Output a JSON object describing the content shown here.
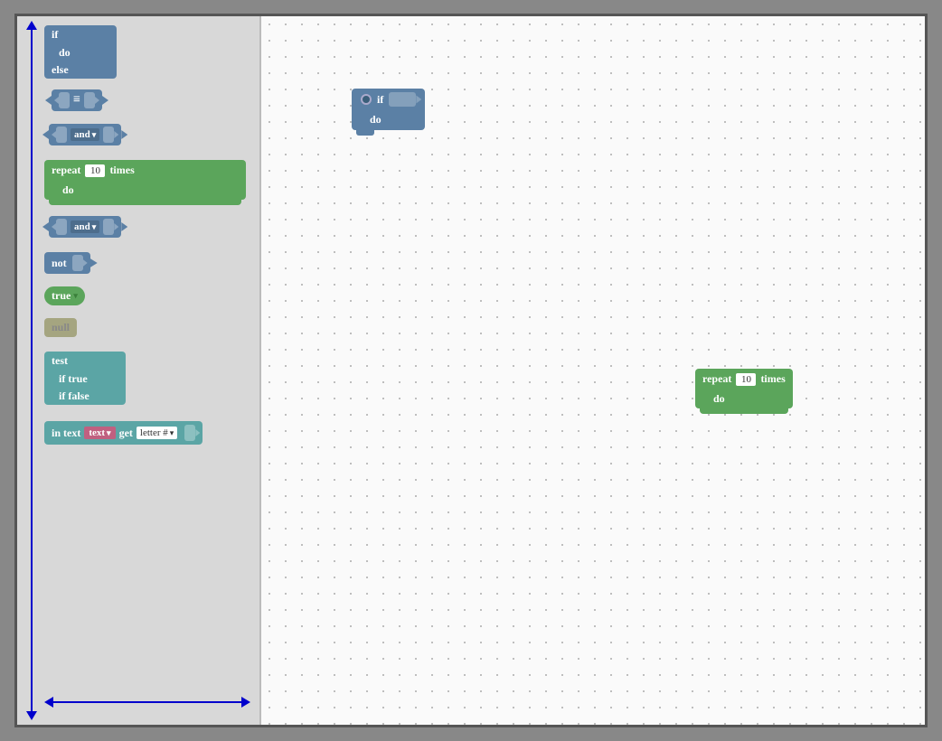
{
  "sidebar": {
    "blocks": {
      "if_do_else": {
        "if_label": "if",
        "do_label": "do",
        "else_label": "else"
      },
      "equals": {
        "symbol": "="
      },
      "and1": {
        "label": "and"
      },
      "repeat": {
        "label": "repeat",
        "times_label": "times",
        "do_label": "do",
        "value": "10"
      },
      "and2": {
        "label": "and"
      },
      "not": {
        "label": "not"
      },
      "true_block": {
        "label": "true"
      },
      "null_block": {
        "label": "null"
      },
      "test_block": {
        "test_label": "test",
        "if_true_label": "if true",
        "if_false_label": "if false"
      },
      "in_text": {
        "in_label": "in text",
        "text_label": "text",
        "get_label": "get",
        "letter_label": "letter #"
      }
    }
  },
  "canvas": {
    "if_block": {
      "if_label": "if",
      "do_label": "do"
    },
    "repeat_block": {
      "label": "repeat",
      "times_label": "times",
      "do_label": "do",
      "value": "10"
    }
  }
}
